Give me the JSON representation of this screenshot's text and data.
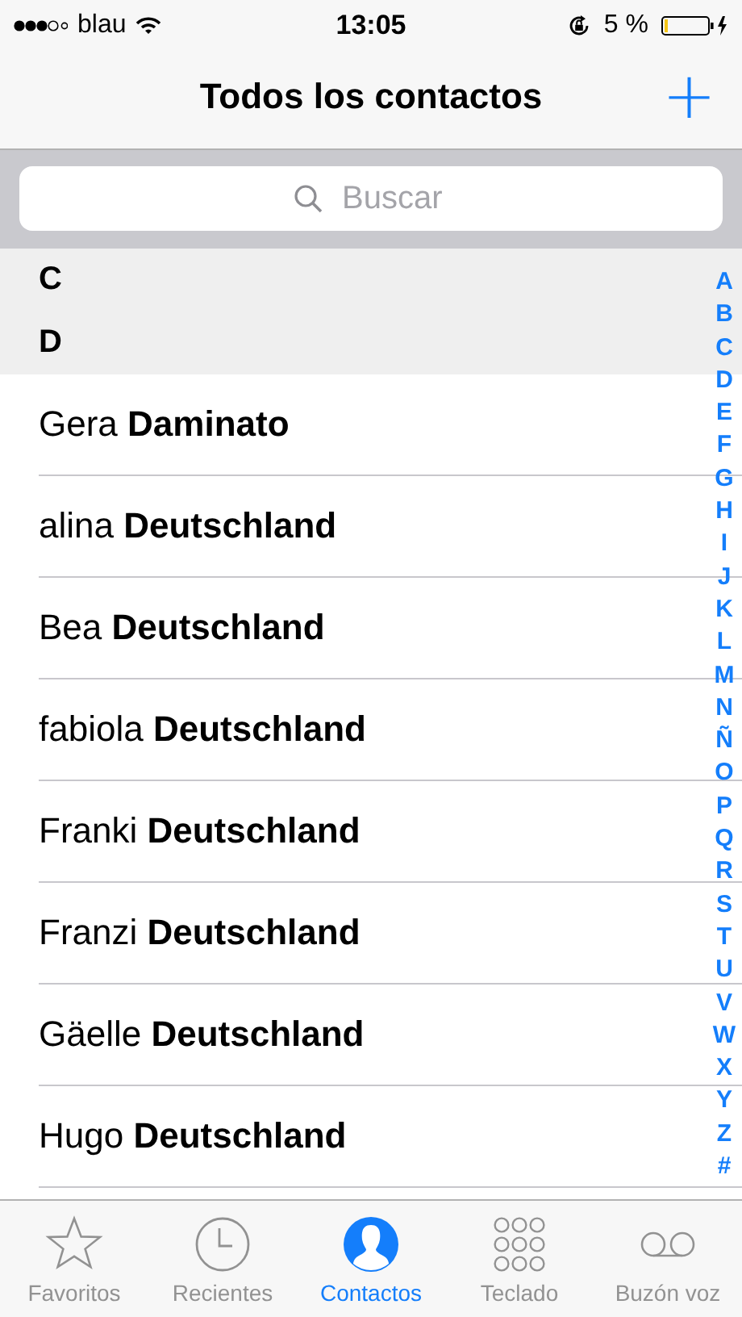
{
  "status_bar": {
    "carrier": "blau",
    "time": "13:05",
    "battery": "5 %"
  },
  "nav": {
    "title": "Todos los contactos",
    "add": "+"
  },
  "search": {
    "placeholder": "Buscar"
  },
  "sections": [
    {
      "letter": "C"
    },
    {
      "letter": "D",
      "contacts": [
        "Gera **Daminato**",
        "alina **Deutschland**",
        "Bea **Deutschland**",
        "fabiola **Deutschland**",
        "Franki **Deutschland**",
        "Franzi **Deutschland**",
        "Gäelle **Deutschland**",
        "Hugo **Deutschland**"
      ]
    }
  ],
  "index": [
    "A",
    "B",
    "C",
    "D",
    "E",
    "F",
    "G",
    "H",
    "I",
    "J",
    "K",
    "L",
    "M",
    "N",
    "Ñ",
    "O",
    "P",
    "Q",
    "R",
    "S",
    "T",
    "U",
    "V",
    "W",
    "X",
    "Y",
    "Z",
    "#"
  ],
  "tabs": [
    {
      "label": "Favoritos",
      "kind": "star",
      "selected": false
    },
    {
      "label": "Recientes",
      "kind": "clock",
      "selected": false
    },
    {
      "label": "Contactos",
      "kind": "person",
      "selected": true
    },
    {
      "label": "Teclado",
      "kind": "keypad",
      "selected": false
    },
    {
      "label": "Buzón voz",
      "kind": "voicemail",
      "selected": false
    }
  ]
}
